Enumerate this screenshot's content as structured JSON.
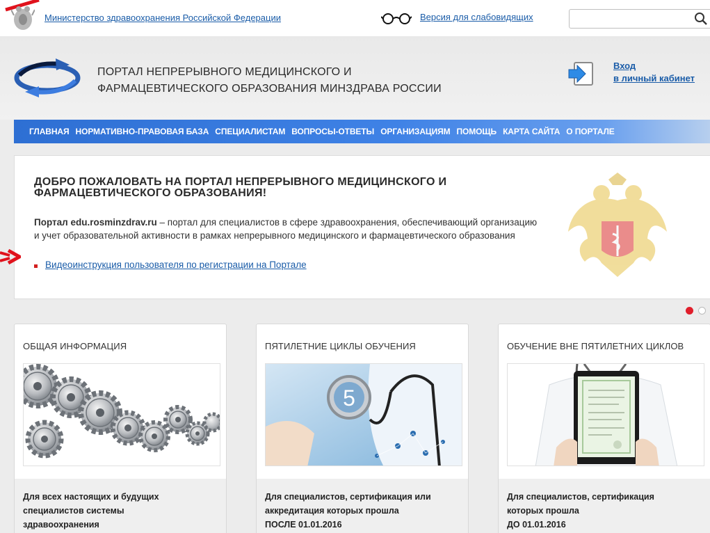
{
  "topbar": {
    "ministry_link": "Министерство здравоохранения Российской Федерации",
    "vision_link": "Версия для слабовидящих",
    "search_placeholder": ""
  },
  "header": {
    "title_line1": "ПОРТАЛ НЕПРЕРЫВНОГО МЕДИЦИНСКОГО И",
    "title_line2": "ФАРМАЦЕВТИЧЕСКОГО ОБРАЗОВАНИЯ МИНЗДРАВА РОССИИ",
    "login_line1": "Вход",
    "login_line2": "в личный кабинет"
  },
  "nav": {
    "items": [
      "ГЛАВНАЯ",
      "НОРМАТИВНО-ПРАВОВАЯ БАЗА",
      "СПЕЦИАЛИСТАМ",
      "ВОПРОСЫ-ОТВЕТЫ",
      "ОРГАНИЗАЦИЯМ",
      "ПОМОЩЬ",
      "КАРТА САЙТА",
      "О ПОРТАЛЕ"
    ]
  },
  "welcome": {
    "title_line1": "ДОБРО ПОЖАЛОВАТЬ НА ПОРТАЛ НЕПРЕРЫВНОГО МЕДИЦИНСКОГО И",
    "title_line2": "ФАРМАЦЕВТИЧЕСКОГО ОБРАЗОВАНИЯ!",
    "portal_name": "Портал edu.rosminzdrav.ru",
    "text_part1": " – портал для специалистов в сфере здравоохранения, обеспечивающий организацию",
    "text_part2": "и учет образовательной активности в рамках непрерывного медицинского и фармацевтического образования",
    "video_link": "Видеоинструкция пользователя по регистрации на Портале"
  },
  "slider": {
    "active_index": 0,
    "count": 2
  },
  "cards": [
    {
      "title": "ОБЩАЯ ИНФОРМАЦИЯ",
      "desc_line1": "Для всех настоящих и будущих",
      "desc_line2": "специалистов системы",
      "desc_line3": "здравоохранения"
    },
    {
      "title": "ПЯТИЛЕТНИЕ ЦИКЛЫ ОБУЧЕНИЯ",
      "image_number": "5",
      "desc_line1": "Для специалистов, сертификация или",
      "desc_line2": "аккредитация которых прошла",
      "desc_line3": "ПОСЛЕ 01.01.2016"
    },
    {
      "title": "ОБУЧЕНИЕ ВНЕ ПЯТИЛЕТНИХ ЦИКЛОВ",
      "desc_line1": "Для специалистов, сертификация",
      "desc_line2": "которых прошла",
      "desc_line3": "ДО 01.01.2016"
    }
  ],
  "colors": {
    "link": "#1a5ca8",
    "nav": "#2e6fd3",
    "accent_red": "#e01e2b"
  }
}
